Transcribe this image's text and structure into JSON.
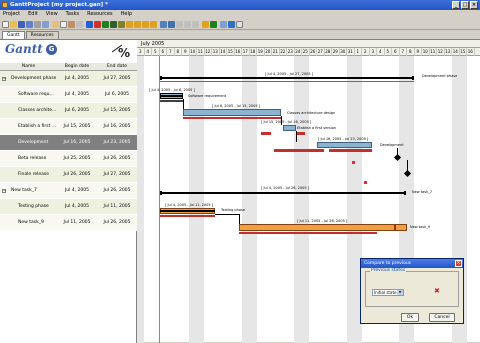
{
  "window": {
    "title": "GanttProject [my project.gan] *"
  },
  "menu": [
    "Project",
    "Edit",
    "View",
    "Tasks",
    "Resources",
    "Help"
  ],
  "tabs": [
    {
      "label": "Gantt"
    },
    {
      "label": "Resources"
    }
  ],
  "columns": {
    "name": "Name",
    "begin": "Begin date",
    "end": "End date"
  },
  "tasks": [
    {
      "name": "Development phase",
      "begin": "Jul 4, 2005",
      "end": "Jul 27, 2005",
      "expander": "−"
    },
    {
      "name": "Software requ...",
      "begin": "Jul 4, 2005",
      "end": "Jul 6, 2005",
      "expander": ""
    },
    {
      "name": "Classes archite...",
      "begin": "Jul 6, 2005",
      "end": "Jul 15, 2005",
      "expander": ""
    },
    {
      "name": "Etablish a first ...",
      "begin": "Jul 15, 2005",
      "end": "Jul 16, 2005",
      "expander": ""
    },
    {
      "name": "Development",
      "begin": "Jul 16, 2005",
      "end": "Jul 23, 2005",
      "expander": ""
    },
    {
      "name": "Beta release",
      "begin": "Jul 25, 2005",
      "end": "Jul 26, 2005",
      "expander": ""
    },
    {
      "name": "Finale release",
      "begin": "Jul 26, 2005",
      "end": "Jul 27, 2005",
      "expander": ""
    },
    {
      "name": "New task_7",
      "begin": "Jul 4, 2005",
      "end": "Jul 26, 2005",
      "expander": "−"
    },
    {
      "name": "Testing phase",
      "begin": "Jul 4, 2005",
      "end": "Jul 11, 2005",
      "expander": ""
    },
    {
      "name": "New task_9",
      "begin": "Jul 11, 2005",
      "end": "Jul 26, 2005",
      "expander": ""
    }
  ],
  "chart": {
    "month": "July 2005",
    "days": [
      "3",
      "4",
      "5",
      "6",
      "7",
      "8",
      "9",
      "10",
      "11",
      "12",
      "13",
      "14",
      "15",
      "16",
      "17",
      "18",
      "19",
      "20",
      "21",
      "22",
      "23",
      "24",
      "25",
      "26",
      "27",
      "28",
      "29",
      "30",
      "31",
      "1",
      "2",
      "3",
      "4",
      "5",
      "6",
      "7",
      "8",
      "9",
      "10",
      "11",
      "12",
      "13",
      "14",
      "15",
      "16"
    ]
  },
  "bar_labels": {
    "dev_dates": "[ Jul 4, 2005 - Jul 27, 2005 ]",
    "dev_name": "Development phase",
    "soft_dates": "[ Jul 4, 2005 - Jul 6, 2005 ]",
    "soft_name": "Software requirement",
    "class_dates": "[ Jul 6, 2005 - Jul 15, 2005 ]",
    "class_name": "Classes architecture design",
    "first_dates": "[ Jul 15, 2005 - Jul 16, 2005 ]",
    "first_name": "Etablish a first version",
    "devt_dates": "[ Jul 16, 2005 - Jul 23, 2005 ]",
    "devt_name": "Development",
    "nt7_dates": "[ Jul 4, 2005 - Jul 26, 2005 ]",
    "nt7_name": "New task_7",
    "test_dates": "[ Jul 4, 2005 - Jul 11, 2005 ]",
    "test_name": "Testing phase",
    "nt9_dates": "[ Jul 11, 2005 - Jul 26, 2005 ]",
    "nt9_name": "New task_9"
  },
  "dialog": {
    "title": "Compare to previous",
    "group_label": "Previous states",
    "selected": "Initial state",
    "ok": "Ok",
    "cancel": "Cancel"
  },
  "logo": {
    "text": "Gantt",
    "circle": "G",
    "sub": "project"
  }
}
